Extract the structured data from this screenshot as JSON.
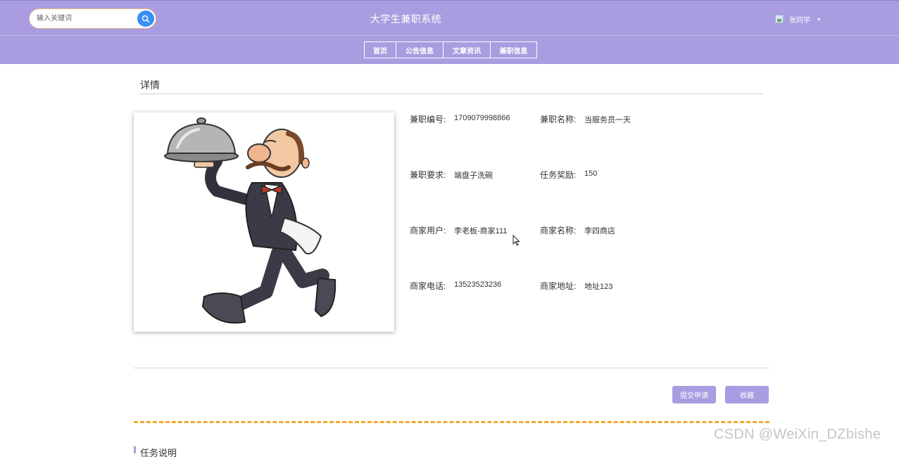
{
  "header": {
    "search_placeholder": "输入关键词",
    "site_title": "大学生兼职系统",
    "username": "张同学"
  },
  "nav": {
    "items": [
      {
        "label": "首页"
      },
      {
        "label": "公告信息"
      },
      {
        "label": "文章资讯"
      },
      {
        "label": "兼职信息"
      }
    ]
  },
  "detail": {
    "section_title": "详情",
    "fields": {
      "job_no_label": "兼职编号:",
      "job_no": "1709079998866",
      "job_name_label": "兼职名称:",
      "job_name": "当服务员一天",
      "requirement_label": "兼职要求:",
      "requirement": "端盘子洗碗",
      "reward_label": "任务奖励:",
      "reward": "150",
      "merchant_user_label": "商家用户:",
      "merchant_user": "李老板-商家111",
      "merchant_name_label": "商家名称:",
      "merchant_name": "李四商店",
      "merchant_phone_label": "商家电话:",
      "merchant_phone": "13523523236",
      "merchant_address_label": "商家地址:",
      "merchant_address": "地址123"
    }
  },
  "actions": {
    "apply": "提交申请",
    "favorite": "收藏"
  },
  "description": {
    "title": "任务说明"
  },
  "watermark": "CSDN @WeiXin_DZbishe",
  "colors": {
    "header_bg": "#aa9ce0",
    "search_button": "#3a8ef6",
    "dashed_line": "#f0a830"
  }
}
